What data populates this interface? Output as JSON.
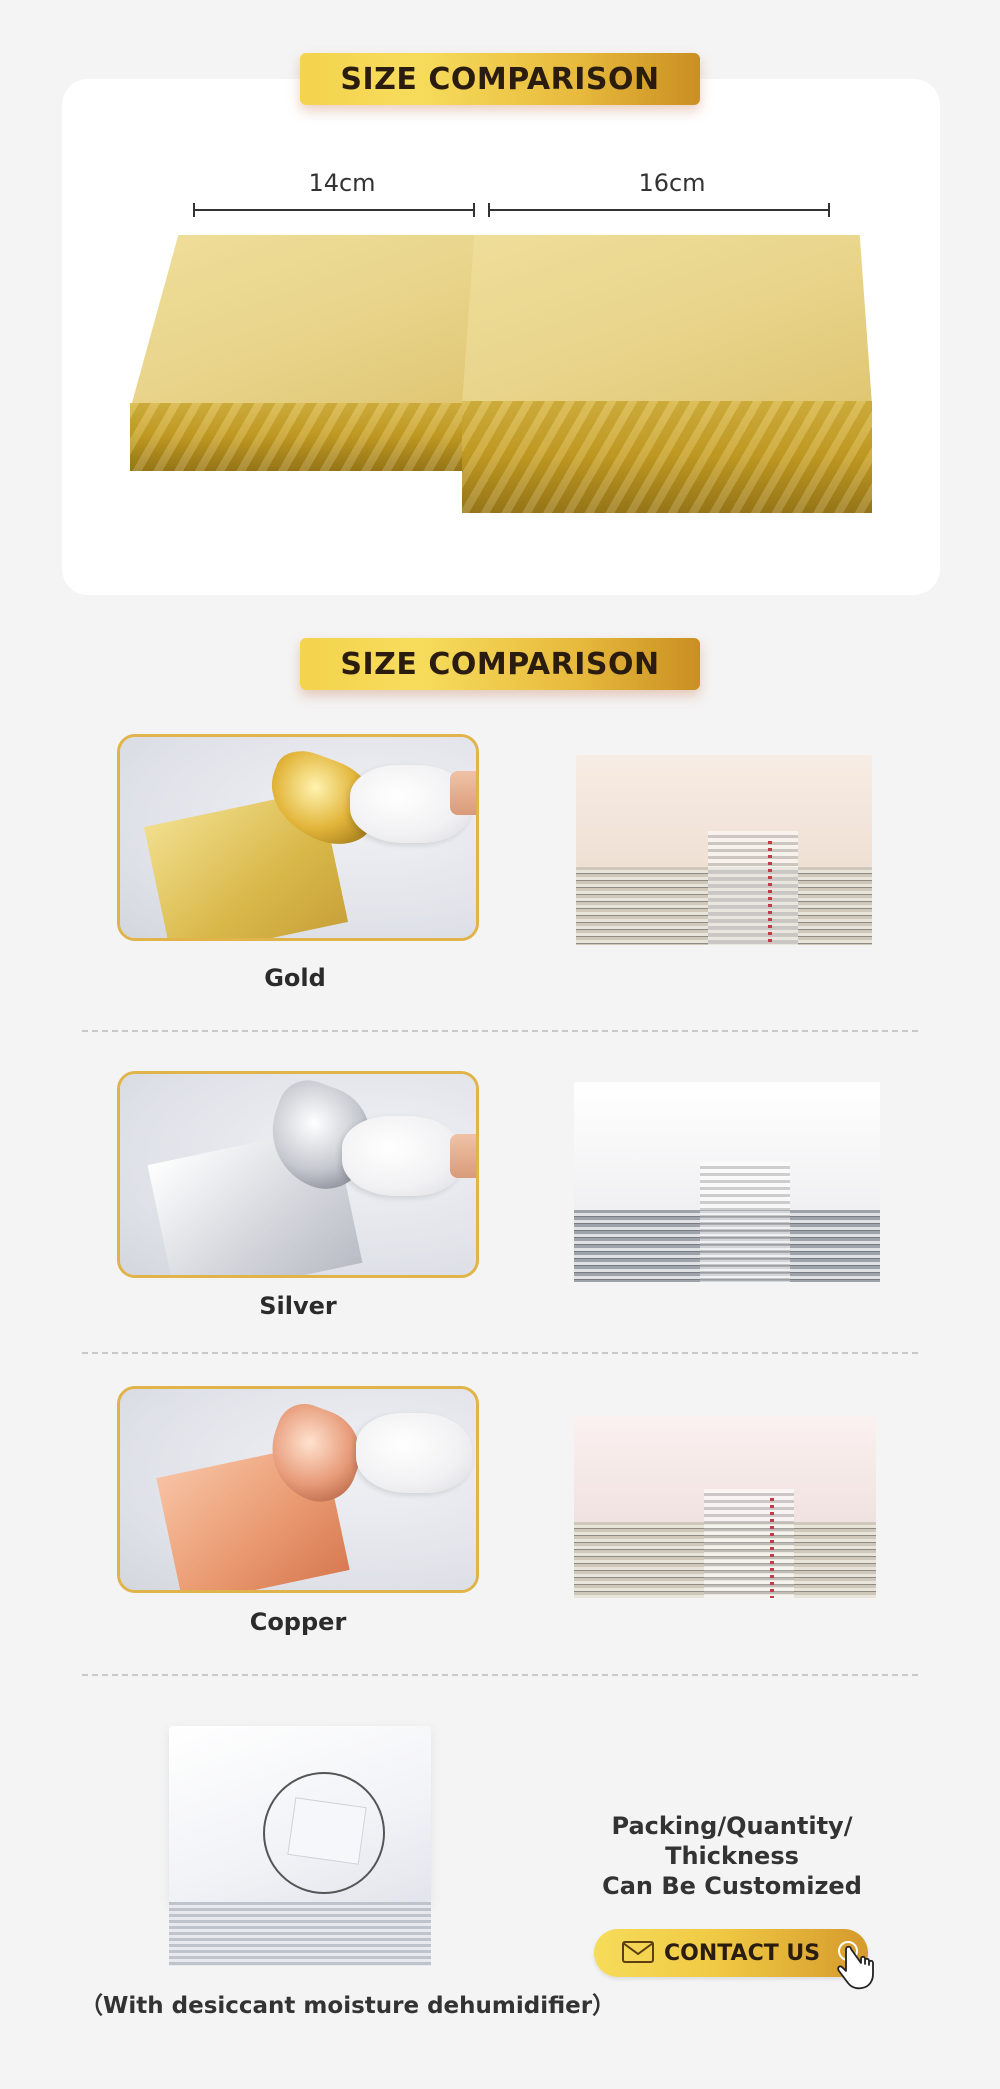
{
  "section1": {
    "banner": "SIZE COMPARISON",
    "dim_left": "14cm",
    "dim_right": "16cm"
  },
  "section2": {
    "banner": "SIZE COMPARISON",
    "rows": [
      {
        "caption": "Gold",
        "foil_color": "#d8b64a",
        "stack_top": "#f3e7dc"
      },
      {
        "caption": "Silver",
        "foil_color": "#d9dbe0",
        "stack_top": "#f6f6f7"
      },
      {
        "caption": "Copper",
        "foil_color": "#e89a74",
        "stack_top": "#f4e6e3"
      }
    ]
  },
  "custom": {
    "line1": "Packing/Quantity/",
    "line2": "Thickness",
    "line3": "Can Be Customized",
    "contact_label": "CONTACT US"
  },
  "desiccant_note": "（With desiccant moisture dehumidifier）",
  "colors": {
    "gold_accent": "#e0b44a",
    "background": "#f4f4f4"
  },
  "icons": [
    "mail-icon",
    "pointer-hand-icon"
  ]
}
